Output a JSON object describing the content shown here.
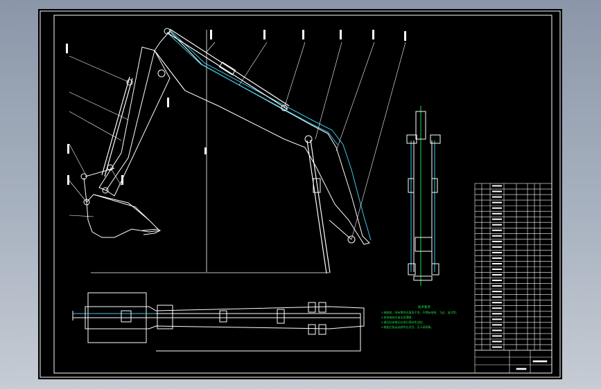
{
  "drawing": {
    "colors": {
      "background": "#000000",
      "line": "#ffffff",
      "hidden": "#3ac8e8",
      "note": "#22e040",
      "frame": "#ffffff",
      "viewport": "#9aa5b4"
    },
    "notes_block": {
      "heading": "技术要求",
      "lines": [
        "1.装配前，所有零件应清洗干净，不得有毛刺、飞边、油污等；",
        "2.各铰接处应加注润滑脂；",
        "3.液压缸安装后应进行密封性试验；",
        "4.装配后各运动部件应灵活，无卡滞现象。"
      ]
    },
    "balloon_count": 14,
    "parts_rows": 30
  }
}
